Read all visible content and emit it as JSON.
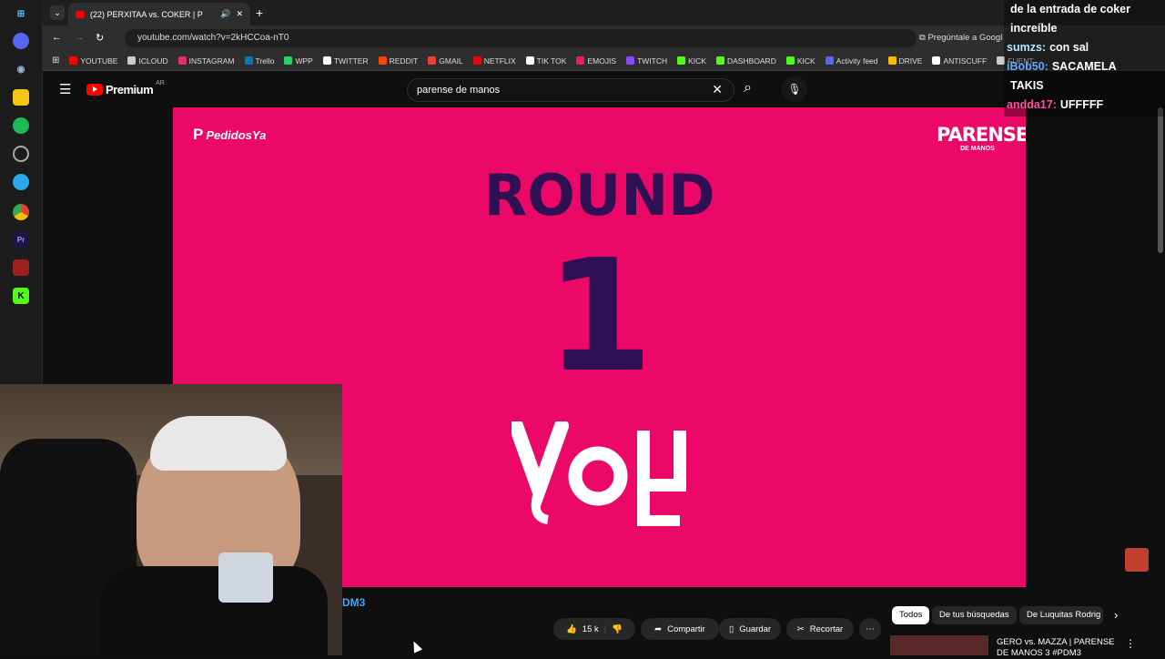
{
  "browser": {
    "tab_title": "(22) PERXITAA vs. COKER | P",
    "url": "youtube.com/watch?v=2kHCCoa-nT0",
    "ask_google": "Pregúntale a Googl"
  },
  "bookmarks": [
    {
      "label": "YOUTUBE",
      "color": "#ff0000"
    },
    {
      "label": "ICLOUD",
      "color": "#cccccc"
    },
    {
      "label": "INSTAGRAM",
      "color": "#e1306c"
    },
    {
      "label": "Trello",
      "color": "#0079bf"
    },
    {
      "label": "WPP",
      "color": "#25d366"
    },
    {
      "label": "TWITTER",
      "color": "#ffffff"
    },
    {
      "label": "REDDIT",
      "color": "#ff4500"
    },
    {
      "label": "GMAIL",
      "color": "#ea4335"
    },
    {
      "label": "NETFLIX",
      "color": "#e50914"
    },
    {
      "label": "TIK TOK",
      "color": "#ffffff"
    },
    {
      "label": "EMOJIS",
      "color": "#e91e63"
    },
    {
      "label": "TWITCH",
      "color": "#9146ff"
    },
    {
      "label": "KICK",
      "color": "#53fc18"
    },
    {
      "label": "DASHBOARD",
      "color": "#53fc18"
    },
    {
      "label": "KICK",
      "color": "#53fc18"
    },
    {
      "label": "Activity feed",
      "color": "#5865f2"
    },
    {
      "label": "DRIVE",
      "color": "#fbbc04"
    },
    {
      "label": "ANTISCUFF",
      "color": "#ffffff"
    },
    {
      "label": "FUENT",
      "color": "#cccccc"
    }
  ],
  "youtube": {
    "logo_text": "Premium",
    "region": "AR",
    "search_value": "parense de manos"
  },
  "video": {
    "sponsor": "PedidosYa",
    "event_logo": "PARENSE",
    "event_logo_sub": "DE MANOS",
    "round_label": "ROUND",
    "round_number": "1",
    "fragment": "DM3"
  },
  "actions": {
    "likes": "15 k",
    "share": "Compartir",
    "save": "Guardar",
    "clip": "Recortar"
  },
  "chips": [
    "Todos",
    "De tus búsquedas",
    "De Luquitas Rodrig"
  ],
  "recommended": {
    "title_line1": "GERO vs. MAZZA | PARENSE",
    "title_line2": "DE MANOS 3 #PDM3"
  },
  "chat": [
    {
      "user": "",
      "msg": "de la entrada de coker",
      "color": "#ffffff"
    },
    {
      "user": "",
      "msg": "increíble",
      "color": "#ffffff"
    },
    {
      "user": "sumzs:",
      "msg": "con sal",
      "color": "#b4e7ff"
    },
    {
      "user": "iBob50:",
      "msg": "SACAMELA",
      "color": "#5fa8ff"
    },
    {
      "user": "",
      "msg": "TAKIS",
      "color": "#ffffff"
    },
    {
      "user": "andda17:",
      "msg": "UFFFFF",
      "color": "#ff4fa3"
    }
  ],
  "colors": {
    "player_bg": "#ec0868",
    "round_text": "#2f1054"
  }
}
